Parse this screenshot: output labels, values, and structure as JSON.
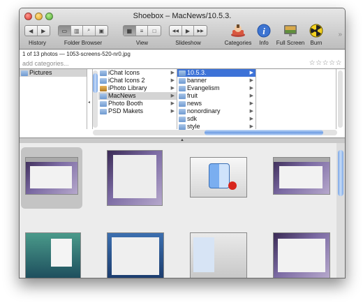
{
  "window": {
    "title": "Shoebox – MacNews/10.5.3."
  },
  "toolbar": {
    "history_label": "History",
    "folder_browser_label": "Folder Browser",
    "view_label": "View",
    "slideshow_label": "Slideshow",
    "categories_label": "Categories",
    "info_label": "Info",
    "fullscreen_label": "Full Screen",
    "burn_label": "Burn",
    "overflow": "»"
  },
  "glyphs": {
    "back": "◀",
    "forward": "▶",
    "first": "◀◀",
    "last": "▶▶",
    "play": "▶▶",
    "rewind": "◀◀",
    "search": "🔍",
    "camera": "📷",
    "grip": "▲"
  },
  "info": {
    "status": "1 of 13 photos — 1053-screens-520-nr0.jpg",
    "category_placeholder": "add categories...",
    "stars": "☆☆☆☆☆"
  },
  "browser": {
    "col1": [
      {
        "label": "Pictures"
      }
    ],
    "col2": [
      {
        "label": "iChat Icons"
      },
      {
        "label": "iChat Icons 2"
      },
      {
        "label": "iPhoto Library"
      },
      {
        "label": "MacNews"
      },
      {
        "label": "Photo Booth"
      },
      {
        "label": "PSD Makets"
      }
    ],
    "col3": [
      {
        "label": "10.5.3."
      },
      {
        "label": "banner"
      },
      {
        "label": "Evangelism"
      },
      {
        "label": "fruit"
      },
      {
        "label": "news"
      },
      {
        "label": "nonordinary"
      },
      {
        "label": "sdk"
      },
      {
        "label": "style"
      }
    ],
    "arrow": "▶"
  },
  "colors": {
    "selection": "#3d72d7",
    "accent_scroll": "#6f9de4"
  },
  "icons": {
    "categories": "categories-icon",
    "info": "info-icon",
    "fullscreen": "fullscreen-icon",
    "burn": "burn-icon"
  }
}
